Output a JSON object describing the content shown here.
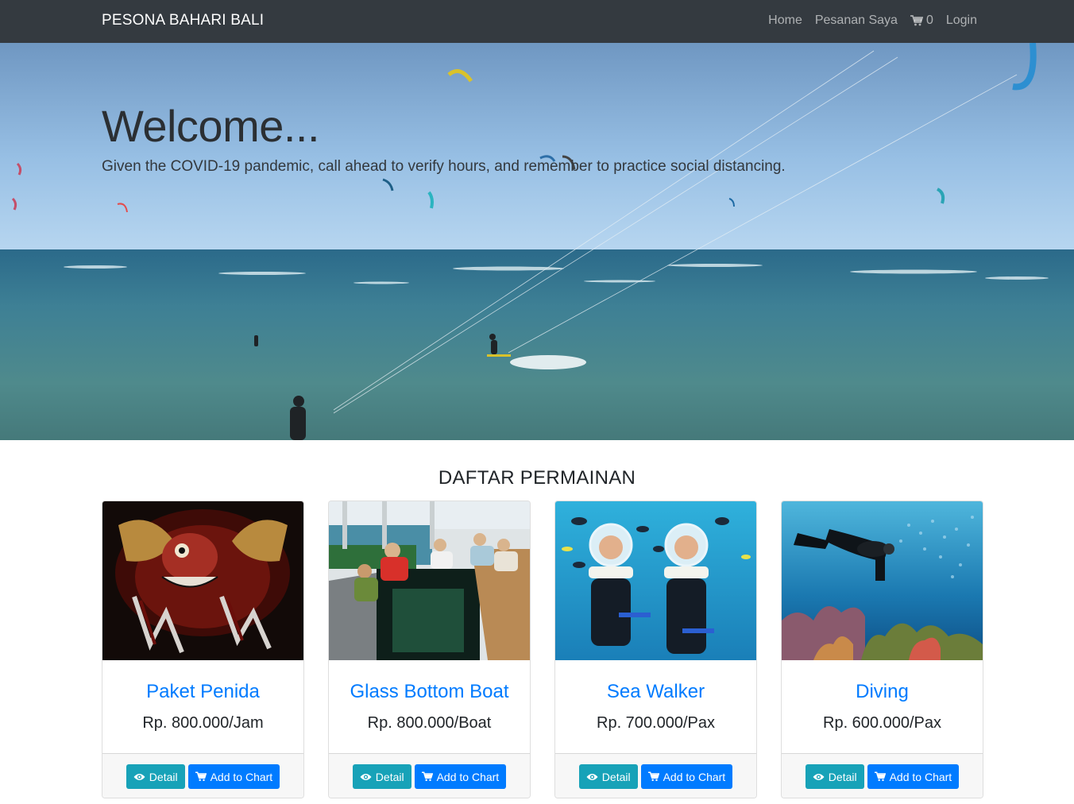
{
  "navbar": {
    "brand": "PESONA BAHARI BALI",
    "links": {
      "home": "Home",
      "orders": "Pesanan Saya",
      "cart_count": "0",
      "login": "Login"
    }
  },
  "hero": {
    "title": "Welcome...",
    "subtitle": "Given the COVID-19 pandemic, call ahead to verify hours, and remember to practice social distancing."
  },
  "section": {
    "title": "DAFTAR PERMAINAN"
  },
  "buttons": {
    "detail": "Detail",
    "add": "Add to Chart"
  },
  "products": [
    {
      "name": "Paket Penida",
      "price": "Rp. 800.000/Jam"
    },
    {
      "name": "Glass Bottom Boat",
      "price": "Rp. 800.000/Boat"
    },
    {
      "name": "Sea Walker",
      "price": "Rp. 700.000/Pax"
    },
    {
      "name": "Diving",
      "price": "Rp. 600.000/Pax"
    }
  ],
  "icons": {
    "cart": "cart-icon",
    "eye": "eye-icon"
  },
  "colors": {
    "navbar_bg": "#343a40",
    "link_blue": "#007bff",
    "info": "#17a2b8",
    "primary": "#007bff"
  }
}
